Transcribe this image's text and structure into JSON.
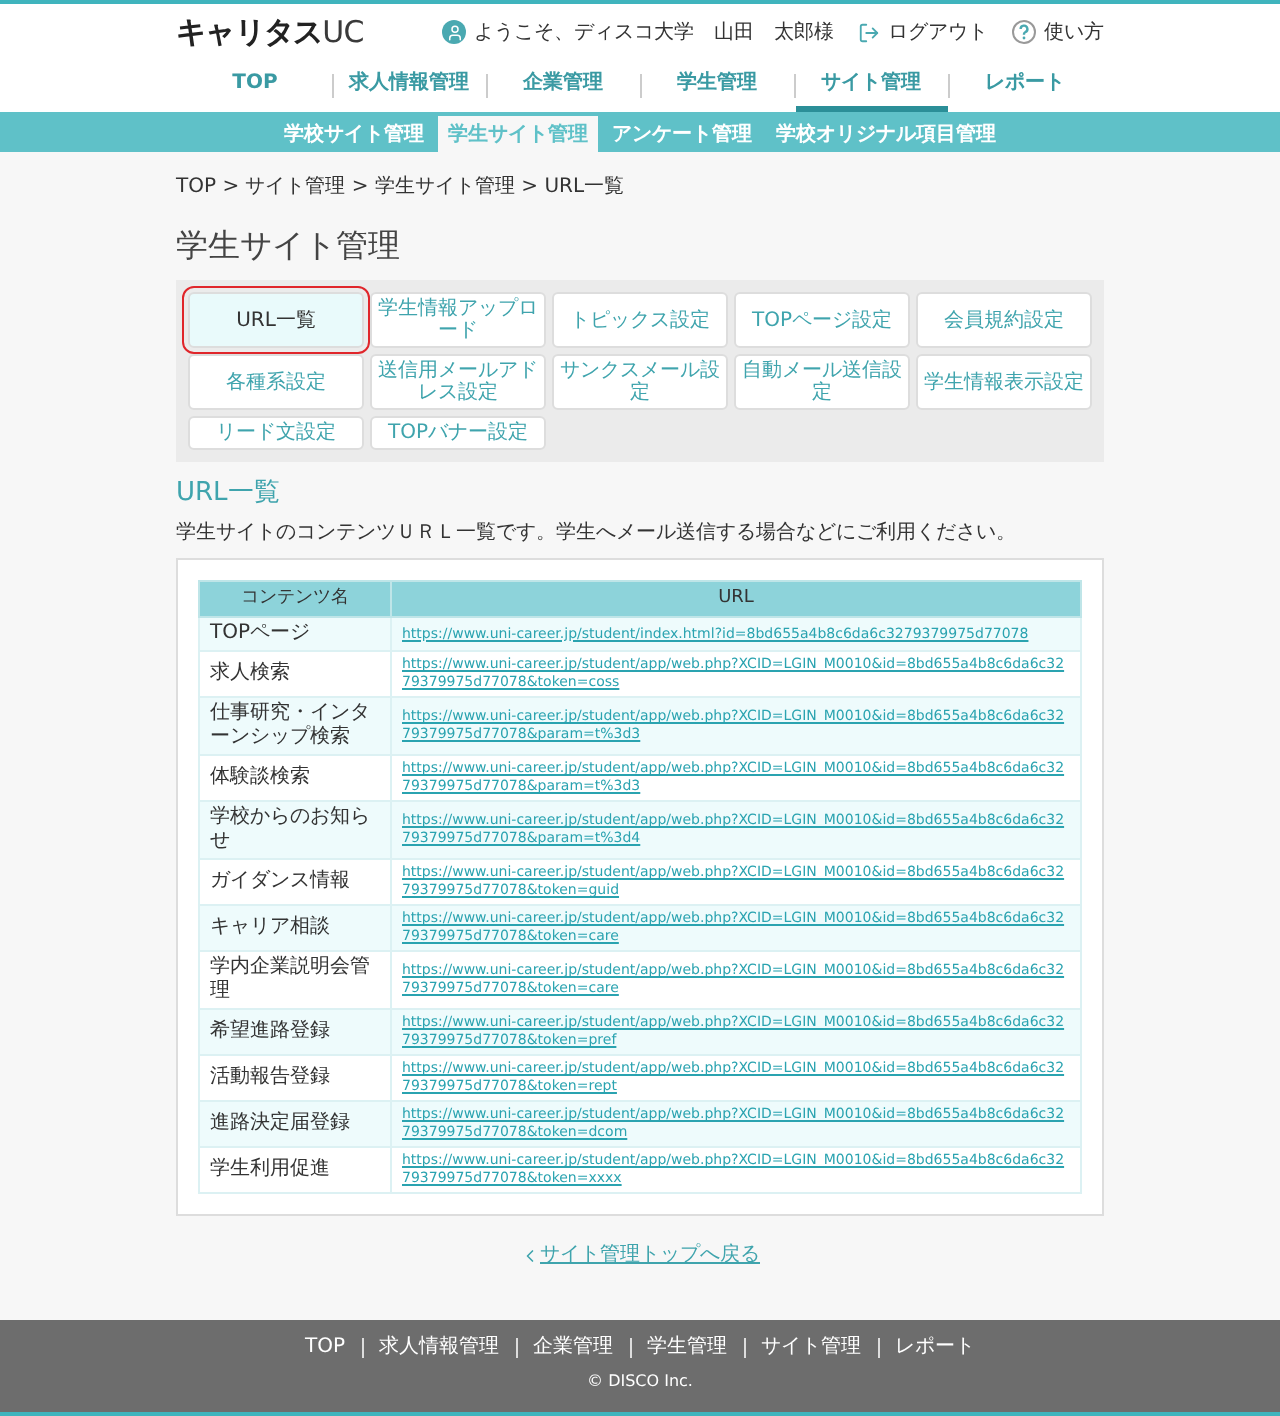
{
  "header": {
    "logo": {
      "main": "キャリタス",
      "accent": "UC"
    },
    "user": "ようこそ、ディスコ大学　山田　太郎様",
    "logout": "ログアウト",
    "help": "使い方"
  },
  "nav": [
    {
      "label": "TOP",
      "selected": false
    },
    {
      "label": "求人情報管理",
      "selected": false
    },
    {
      "label": "企業管理",
      "selected": false
    },
    {
      "label": "学生管理",
      "selected": false
    },
    {
      "label": "サイト管理",
      "selected": true
    },
    {
      "label": "レポート",
      "selected": false
    }
  ],
  "subnav": [
    {
      "label": "学校サイト管理",
      "selected": false
    },
    {
      "label": "学生サイト管理",
      "selected": true
    },
    {
      "label": "アンケート管理",
      "selected": false
    },
    {
      "label": "学校オリジナル項目管理",
      "selected": false
    }
  ],
  "breadcrumb": "TOP > サイト管理 > 学生サイト管理 > URL一覧",
  "page_title": "学生サイト管理",
  "menu_buttons": [
    {
      "label": "URL一覧",
      "selected": true
    },
    {
      "label": "学生情報アップロード",
      "selected": false
    },
    {
      "label": "トピックス設定",
      "selected": false
    },
    {
      "label": "TOPページ設定",
      "selected": false
    },
    {
      "label": "会員規約設定",
      "selected": false
    },
    {
      "label": "各種系設定",
      "selected": false
    },
    {
      "label": "送信用メールアドレス設定",
      "selected": false
    },
    {
      "label": "サンクスメール設定",
      "selected": false
    },
    {
      "label": "自動メール送信設定",
      "selected": false
    },
    {
      "label": "学生情報表示設定",
      "selected": false
    },
    {
      "label": "リード文設定",
      "selected": false
    },
    {
      "label": "TOPバナー設定",
      "selected": false
    }
  ],
  "section_title": "URL一覧",
  "description": "学生サイトのコンテンツＵＲＬ一覧です。学生へメール送信する場合などにご利用ください。",
  "table": {
    "columns": [
      "コンテンツ名",
      "URL"
    ],
    "rows": [
      {
        "name": "TOPページ",
        "url": "https://www.uni-career.jp/student/index.html?id=8bd655a4b8c6da6c3279379975d77078"
      },
      {
        "name": "求人検索",
        "url": "https://www.uni-career.jp/student/app/web.php?XCID=LGIN_M0010&id=8bd655a4b8c6da6c3279379975d77078&token=coss"
      },
      {
        "name": "仕事研究・インターンシップ検索",
        "url": "https://www.uni-career.jp/student/app/web.php?XCID=LGIN_M0010&id=8bd655a4b8c6da6c3279379975d77078&param=t%3d3"
      },
      {
        "name": "体験談検索",
        "url": "https://www.uni-career.jp/student/app/web.php?XCID=LGIN_M0010&id=8bd655a4b8c6da6c3279379975d77078&param=t%3d3"
      },
      {
        "name": "学校からのお知らせ",
        "url": "https://www.uni-career.jp/student/app/web.php?XCID=LGIN_M0010&id=8bd655a4b8c6da6c3279379975d77078&param=t%3d4"
      },
      {
        "name": "ガイダンス情報",
        "url": "https://www.uni-career.jp/student/app/web.php?XCID=LGIN_M0010&id=8bd655a4b8c6da6c3279379975d77078&token=guid"
      },
      {
        "name": "キャリア相談",
        "url": "https://www.uni-career.jp/student/app/web.php?XCID=LGIN_M0010&id=8bd655a4b8c6da6c3279379975d77078&token=care"
      },
      {
        "name": "学内企業説明会管理",
        "url": "https://www.uni-career.jp/student/app/web.php?XCID=LGIN_M0010&id=8bd655a4b8c6da6c3279379975d77078&token=care"
      },
      {
        "name": "希望進路登録",
        "url": "https://www.uni-career.jp/student/app/web.php?XCID=LGIN_M0010&id=8bd655a4b8c6da6c3279379975d77078&token=pref"
      },
      {
        "name": "活動報告登録",
        "url": "https://www.uni-career.jp/student/app/web.php?XCID=LGIN_M0010&id=8bd655a4b8c6da6c3279379975d77078&token=rept"
      },
      {
        "name": "進路決定届登録",
        "url": "https://www.uni-career.jp/student/app/web.php?XCID=LGIN_M0010&id=8bd655a4b8c6da6c3279379975d77078&token=dcom"
      },
      {
        "name": "学生利用促進",
        "url": "https://www.uni-career.jp/student/app/web.php?XCID=LGIN_M0010&id=8bd655a4b8c6da6c3279379975d77078&token=xxxx"
      }
    ]
  },
  "back_link": "サイト管理トップへ戻る",
  "footer": {
    "links": [
      "TOP",
      "求人情報管理",
      "企業管理",
      "学生管理",
      "サイト管理",
      "レポート"
    ],
    "copyright": "© DISCO Inc."
  }
}
